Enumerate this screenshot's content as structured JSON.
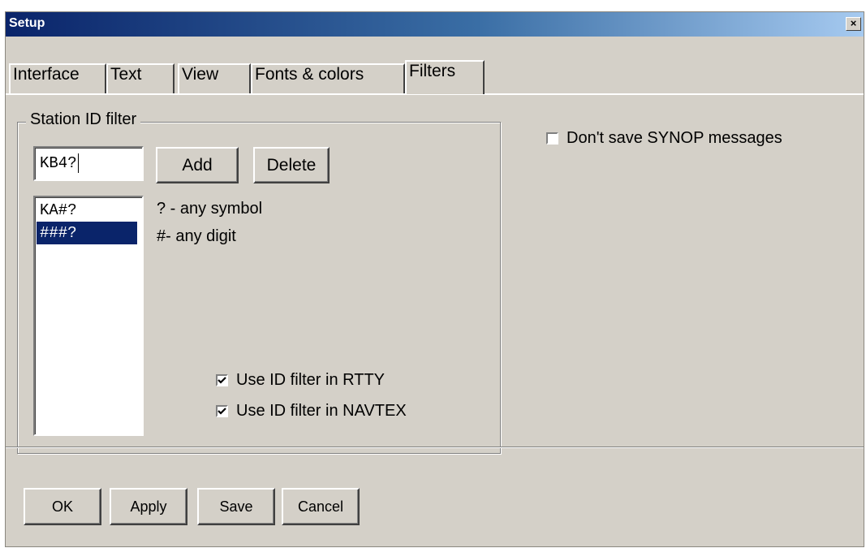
{
  "window": {
    "title": "Setup",
    "close_glyph": "×"
  },
  "tabs": [
    {
      "label": "Interface",
      "selected": false
    },
    {
      "label": "Text",
      "selected": false
    },
    {
      "label": "View",
      "selected": false
    },
    {
      "label": "Fonts & colors",
      "selected": false
    },
    {
      "label": "Filters",
      "selected": true
    }
  ],
  "station_filter": {
    "group_label": "Station ID filter",
    "id_input_value": "KB4?",
    "add_label": "Add",
    "delete_label": "Delete",
    "list": [
      {
        "text": "KA#?",
        "selected": false
      },
      {
        "text": "###?",
        "selected": true
      }
    ],
    "hints": [
      "? - any symbol",
      "#- any digit"
    ],
    "use_in_rtty": {
      "label": "Use ID filter in RTTY",
      "checked": true
    },
    "use_in_navtex": {
      "label": "Use ID filter in NAVTEX",
      "checked": true
    }
  },
  "synop": {
    "label": "Don't save SYNOP messages",
    "checked": false
  },
  "footer": {
    "ok_label": "OK",
    "apply_label": "Apply",
    "save_label": "Save",
    "cancel_label": "Cancel"
  },
  "icons": {
    "close": "close-icon",
    "checkmark": "checkmark-icon"
  }
}
